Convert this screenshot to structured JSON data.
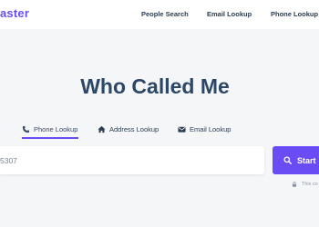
{
  "header": {
    "logo": "aster",
    "nav": {
      "people_search": "People Search",
      "email_lookup": "Email Lookup",
      "phone_lookup": "Phone Lookup"
    }
  },
  "main": {
    "title": "Who Called Me",
    "tabs": [
      {
        "label": "Phone Lookup",
        "icon": "phone-icon",
        "active": true
      },
      {
        "label": "Address Lookup",
        "icon": "home-icon",
        "active": false
      },
      {
        "label": "Email Lookup",
        "icon": "envelope-icon",
        "active": false
      }
    ],
    "search": {
      "value": "5307",
      "button_label": "Start",
      "button_icon": "search-icon"
    },
    "secure_note": "This co"
  },
  "colors": {
    "accent": "#6a4cf5",
    "title": "#2d4866",
    "background": "#f5f6f8"
  }
}
